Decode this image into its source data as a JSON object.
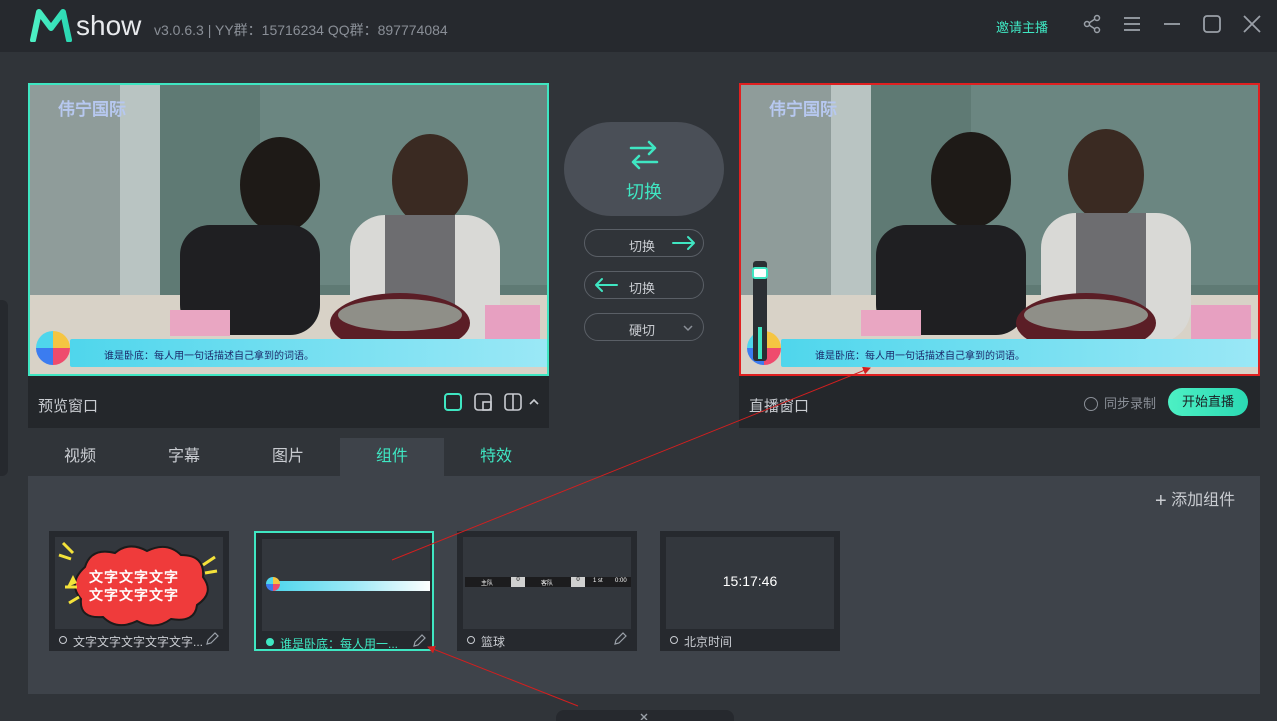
{
  "titlebar": {
    "app_name": "show",
    "version": "v3.0.6.3  |  YY群：15716234  QQ群：897774084",
    "invite_label": "邀请主播",
    "icons": [
      "share-icon",
      "menu-icon",
      "minimize-icon",
      "maximize-icon",
      "close-icon"
    ]
  },
  "preview": {
    "caption": "预览窗口",
    "watermark": "伟宁国际",
    "banner_text": "谁是卧底：每人用一句话描述自己拿到的词语。"
  },
  "live": {
    "caption": "直播窗口",
    "watermark": "伟宁国际",
    "banner_text": "谁是卧底：每人用一句话描述自己拿到的词语。",
    "sync_record_label": "同步录制",
    "go_live_label": "开始直播"
  },
  "switch": {
    "main_label": "切换",
    "to_live_label": "切换",
    "to_preview_label": "切换",
    "hard_cut_label": "硬切"
  },
  "tabs": [
    {
      "label": "视频"
    },
    {
      "label": "字幕"
    },
    {
      "label": "图片"
    },
    {
      "label": "组件",
      "active": true
    },
    {
      "label": "特效"
    }
  ],
  "components": {
    "add_label": "添加组件",
    "cards": [
      {
        "name": "文字文字文字文字文字...",
        "bubble_line1": "文字文字文字",
        "bubble_line2": "文字文字文字"
      },
      {
        "name": "谁是卧底：每人用一...",
        "selected": true
      },
      {
        "name": "篮球",
        "score_left": "0",
        "score_right": "0",
        "period": "1 st",
        "time": "0:00",
        "team_left": "主队",
        "team_right": "客队"
      },
      {
        "name": "北京时间",
        "clock": "15:17:46"
      }
    ]
  },
  "colors": {
    "accent": "#3fe6c2",
    "live_border": "#e02020",
    "preview_border": "#3fe6c2",
    "background": "#303439"
  }
}
